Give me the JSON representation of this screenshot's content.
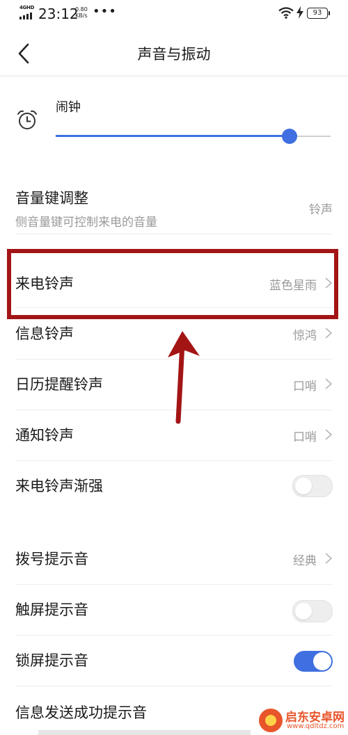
{
  "status_bar": {
    "network": "4GHD",
    "time": "23:12",
    "speed_value": "0.80",
    "speed_unit": "KB/s",
    "more": "•••",
    "battery": "93"
  },
  "header": {
    "title": "声音与振动"
  },
  "alarm": {
    "label": "闹钟",
    "volume_fraction": 0.85
  },
  "rows": {
    "volume_keys": {
      "title": "音量键调整",
      "subtitle": "侧音量键可控制来电的音量",
      "value": "铃声"
    },
    "ringtone": {
      "title": "来电铃声",
      "value": "蓝色星雨"
    },
    "message_tone": {
      "title": "信息铃声",
      "value": "惊鸿"
    },
    "calendar_tone": {
      "title": "日历提醒铃声",
      "value": "口哨"
    },
    "notification_tone": {
      "title": "通知铃声",
      "value": "口哨"
    },
    "ringtone_fade": {
      "title": "来电铃声渐强",
      "enabled": false
    },
    "dial_tone": {
      "title": "拨号提示音",
      "value": "经典"
    },
    "touch_tone": {
      "title": "触屏提示音",
      "enabled": false
    },
    "lock_tone": {
      "title": "锁屏提示音",
      "enabled": true
    },
    "message_sent_tone": {
      "title": "信息发送成功提示音"
    }
  },
  "watermark": {
    "name": "启东安卓网",
    "url": "www.qdltdz.com"
  },
  "colors": {
    "accent": "#3f6fe0",
    "annotation_red": "#a31515",
    "secondary_text": "#9a9a9a"
  }
}
